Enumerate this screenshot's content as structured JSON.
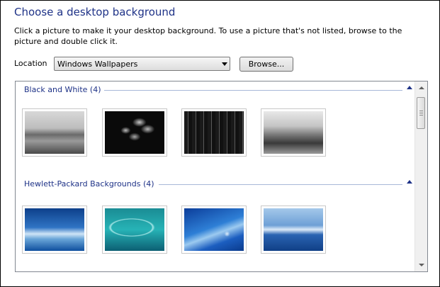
{
  "header": {
    "title": "Choose a desktop background",
    "description": "Click a picture to make it your desktop background. To use a picture that's not listed, browse to the picture and double click it."
  },
  "location": {
    "label": "Location",
    "selected": "Windows Wallpapers",
    "browse_label": "Browse..."
  },
  "groups": [
    {
      "label": "Black and White (4)",
      "thumbnails": [
        "bw-train-interior",
        "bw-leaves",
        "bw-city-night",
        "bw-shore-tree"
      ]
    },
    {
      "label": "Hewlett-Packard Backgrounds (4)",
      "thumbnails": [
        "hp-blue-horizon",
        "hp-teal-swirl",
        "hp-blue-wave-logo",
        "hp-blue-lines"
      ]
    }
  ],
  "colors": {
    "heading": "#1e3287",
    "separator": "#a8b8d8"
  }
}
